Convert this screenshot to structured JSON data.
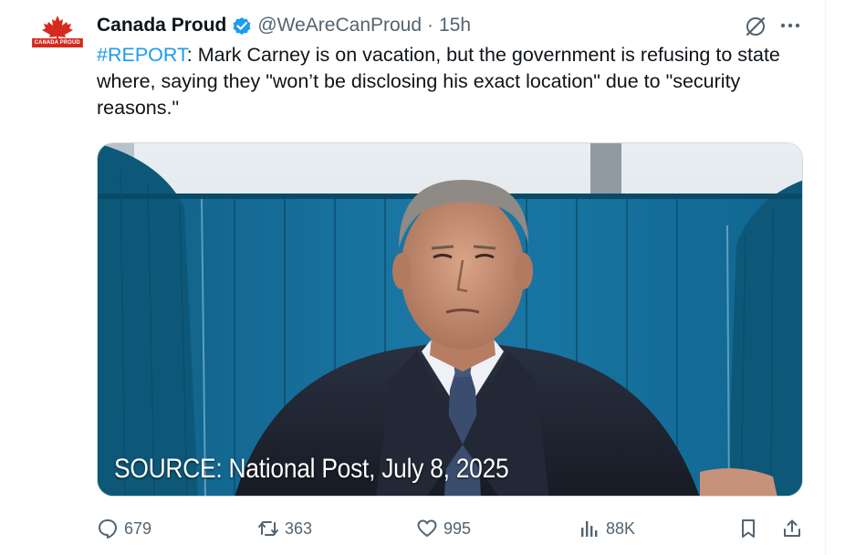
{
  "account": {
    "name": "Canada Proud",
    "handle": "@WeAreCanProud",
    "separator": "·",
    "time": "15h",
    "avatar_text": "CANADA PROUD",
    "verified_color": "#1d9bf0"
  },
  "tweet": {
    "hashtag": "#REPORT",
    "text": ": Mark Carney is on vacation, but the government is refusing to state where, saying they \"won’t be disclosing his exact location\" due to \"security reasons.\""
  },
  "media": {
    "caption": "SOURCE: National Post, July 8, 2025"
  },
  "actions": {
    "replies": "679",
    "reposts": "363",
    "likes": "995",
    "views": "88K"
  },
  "icons": {
    "grok": "grok-icon",
    "more": "more-icon",
    "reply": "reply-icon",
    "repost": "repost-icon",
    "like": "heart-icon",
    "views": "views-icon",
    "bookmark": "bookmark-icon",
    "share": "share-icon"
  },
  "colors": {
    "accent": "#1d9bf0",
    "muted": "#536471",
    "brand_red": "#d52b1e"
  }
}
